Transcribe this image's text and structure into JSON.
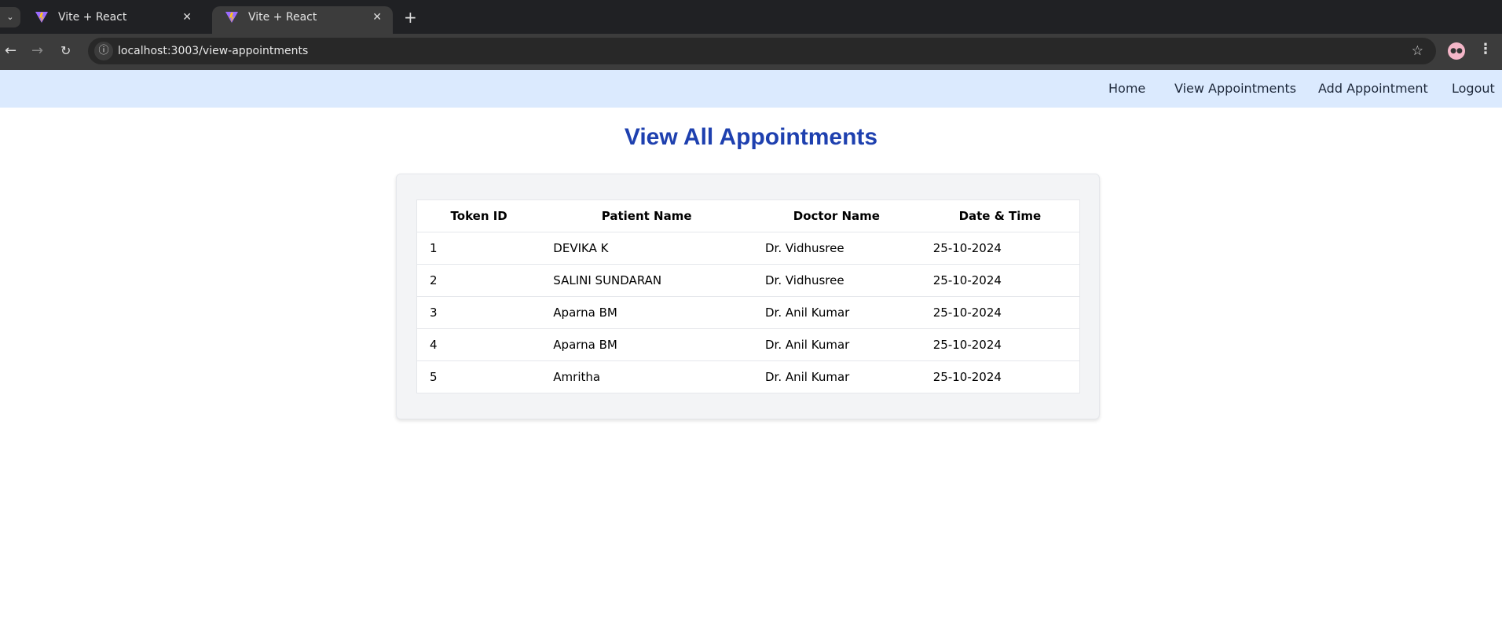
{
  "browser": {
    "tabs": [
      {
        "title": "Vite + React",
        "active": false
      },
      {
        "title": "Vite + React",
        "active": true
      }
    ],
    "url": "localhost:3003/view-appointments"
  },
  "nav": {
    "items": [
      "Home",
      "View Appointments",
      "Add Appointment",
      "Logout"
    ]
  },
  "page": {
    "title": "View All Appointments"
  },
  "table": {
    "headers": [
      "Token ID",
      "Patient Name",
      "Doctor Name",
      "Date & Time"
    ],
    "rows": [
      [
        "1",
        "DEVIKA K",
        "Dr. Vidhusree",
        "25-10-2024"
      ],
      [
        "2",
        "SALINI SUNDARAN",
        "Dr. Vidhusree",
        "25-10-2024"
      ],
      [
        "3",
        "Aparna BM",
        "Dr. Anil Kumar",
        "25-10-2024"
      ],
      [
        "4",
        "Aparna BM",
        "Dr. Anil Kumar",
        "25-10-2024"
      ],
      [
        "5",
        "Amritha",
        "Dr. Anil Kumar",
        "25-10-2024"
      ]
    ]
  },
  "colors": {
    "navbar": "#dbeafe",
    "title": "#1e40af",
    "card": "#f3f4f6"
  }
}
